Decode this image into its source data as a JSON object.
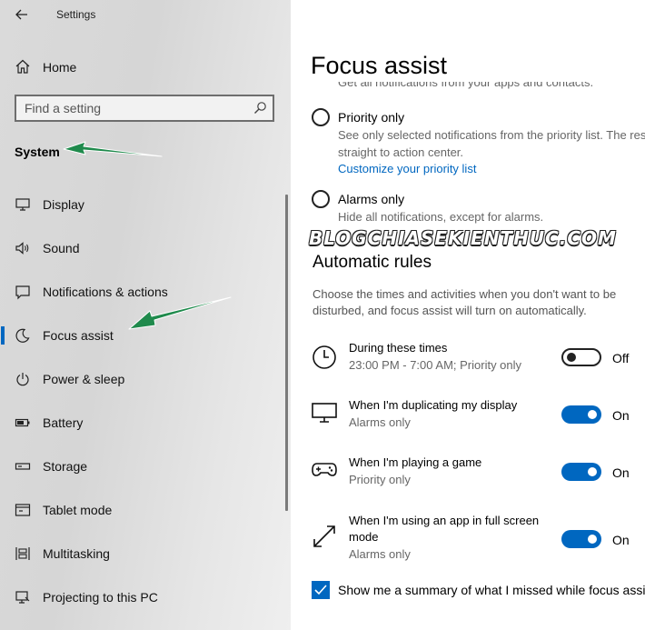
{
  "window": {
    "title": "Settings"
  },
  "sidebar": {
    "home_label": "Home",
    "search": {
      "placeholder": "Find a setting"
    },
    "section_heading": "System",
    "items": [
      {
        "label": "Display",
        "icon": "display-icon"
      },
      {
        "label": "Sound",
        "icon": "sound-icon"
      },
      {
        "label": "Notifications & actions",
        "icon": "notifications-icon"
      },
      {
        "label": "Focus assist",
        "icon": "moon-icon",
        "active": true
      },
      {
        "label": "Power & sleep",
        "icon": "power-icon"
      },
      {
        "label": "Battery",
        "icon": "battery-icon"
      },
      {
        "label": "Storage",
        "icon": "storage-icon"
      },
      {
        "label": "Tablet mode",
        "icon": "tablet-mode-icon"
      },
      {
        "label": "Multitasking",
        "icon": "multitasking-icon"
      },
      {
        "label": "Projecting to this PC",
        "icon": "projecting-icon"
      }
    ]
  },
  "main": {
    "title": "Focus assist",
    "clipped_text": "Get all notifications from your apps and contacts.",
    "options": [
      {
        "label": "Priority only",
        "desc": [
          "See only selected notifications from the priority list. The rest will go",
          "straight to action center."
        ],
        "link": "Customize your priority list"
      },
      {
        "label": "Alarms only",
        "desc": [
          "Hide all notifications, except for alarms."
        ]
      }
    ],
    "watermark": "BLOGCHIASEKIENTHUC.COM",
    "automatic_rules": {
      "heading": "Automatic rules",
      "description": "Choose the times and activities when you don't want to be disturbed, and focus assist will turn on automatically.",
      "rules": [
        {
          "title": "During these times",
          "subtitle": "23:00 PM - 7:00 AM; Priority only",
          "state": "Off",
          "on": false,
          "icon": "clock-icon"
        },
        {
          "title": "When I'm duplicating my display",
          "subtitle": "Alarms only",
          "state": "On",
          "on": true,
          "icon": "monitor-icon"
        },
        {
          "title": "When I'm playing a game",
          "subtitle": "Priority only",
          "state": "On",
          "on": true,
          "icon": "gamepad-icon"
        },
        {
          "title": "When I'm using an app in full screen mode",
          "subtitle": "Alarms only",
          "state": "On",
          "on": true,
          "icon": "fullscreen-icon"
        }
      ]
    },
    "summary_checkbox": {
      "label": "Show me a summary of what I missed while focus assist was on",
      "checked": true
    }
  },
  "colors": {
    "accent": "#0067c0",
    "annotation_arrow": "#1f8a4c",
    "sidebar_bg": "#dadada"
  }
}
